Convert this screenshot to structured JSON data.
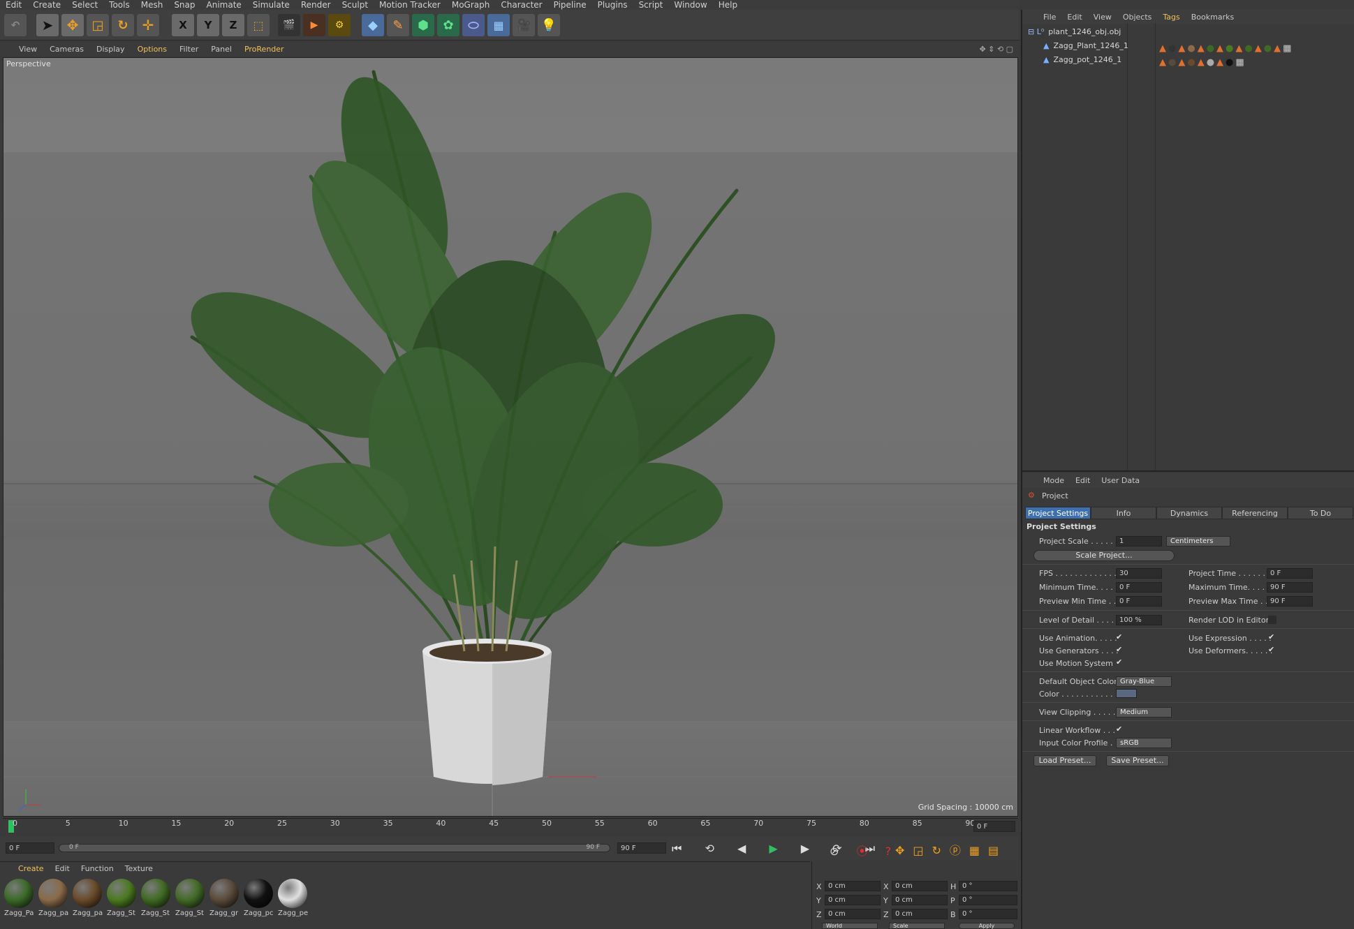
{
  "menu": [
    "Edit",
    "Create",
    "Select",
    "Tools",
    "Mesh",
    "Snap",
    "Animate",
    "Simulate",
    "Render",
    "Sculpt",
    "Motion Tracker",
    "MoGraph",
    "Character",
    "Pipeline",
    "Plugins",
    "Script",
    "Window",
    "Help"
  ],
  "toolbar": {
    "x": "X",
    "y": "Y",
    "z": "Z"
  },
  "viewport_menu": [
    "View",
    "Cameras",
    "Display",
    "Options",
    "Filter",
    "Panel",
    "ProRender"
  ],
  "viewport": {
    "label": "Perspective",
    "grid_spacing": "Grid Spacing : 10000 cm"
  },
  "timeline": {
    "ticks": [
      "0",
      "5",
      "10",
      "15",
      "20",
      "25",
      "30",
      "35",
      "40",
      "45",
      "50",
      "55",
      "60",
      "65",
      "70",
      "75",
      "80",
      "85",
      "90"
    ],
    "current": "0 F"
  },
  "transport": {
    "start": "0 F",
    "range_start": "0 F",
    "range_end": "90 F",
    "end": "90 F"
  },
  "material_menu": [
    "Create",
    "Edit",
    "Function",
    "Texture"
  ],
  "materials": [
    {
      "name": "Zagg_Pa",
      "color": "#3a6a28"
    },
    {
      "name": "Zagg_pa",
      "color": "#8a6a48"
    },
    {
      "name": "Zagg_pa",
      "color": "#6a4a2a"
    },
    {
      "name": "Zagg_St",
      "color": "#4a7a20"
    },
    {
      "name": "Zagg_St",
      "color": "#3f6a22"
    },
    {
      "name": "Zagg_St",
      "color": "#426a26"
    },
    {
      "name": "Zagg_gr",
      "color": "#5a4a3a"
    },
    {
      "name": "Zagg_pc",
      "color": "#111111"
    },
    {
      "name": "Zagg_pe",
      "color": "#e0e0e0"
    }
  ],
  "coords": {
    "x1": "0 cm",
    "x2": "0 cm",
    "h": "0 °",
    "y1": "0 cm",
    "y2": "0 cm",
    "p": "0 °",
    "z1": "0 cm",
    "z2": "0 cm",
    "b": "0 °",
    "world": "World",
    "scale": "Scale",
    "apply": "Apply",
    "labels": {
      "x": "X",
      "y": "Y",
      "z": "Z",
      "h": "H",
      "p": "P",
      "b": "B"
    }
  },
  "object_menu": [
    "File",
    "Edit",
    "View",
    "Objects",
    "Tags",
    "Bookmarks"
  ],
  "objects": [
    {
      "name": "plant_1246_obj.obj",
      "indent": 0
    },
    {
      "name": "Zagg_Plant_1246_1",
      "indent": 1
    },
    {
      "name": "Zagg_pot_1246_1",
      "indent": 1
    }
  ],
  "attr_menu": [
    "Mode",
    "Edit",
    "User Data"
  ],
  "attr": {
    "title": "Project",
    "tabs": [
      "Project Settings",
      "Info",
      "Dynamics",
      "Referencing",
      "To Do"
    ],
    "section": "Project Settings",
    "project_scale_label": "Project Scale . . . . . .",
    "project_scale": "1",
    "scale_unit": "Centimeters",
    "scale_project": "Scale Project...",
    "fps_label": "FPS . . . . . . . . . . . . . .",
    "fps": "30",
    "project_time_label": "Project Time . . . . . . . .",
    "project_time": "0 F",
    "min_time_label": "Minimum Time. . . . .",
    "min_time": "0 F",
    "max_time_label": "Maximum Time. . . . . .",
    "max_time": "90 F",
    "prev_min_label": "Preview Min Time . .",
    "prev_min": "0 F",
    "prev_max_label": "Preview Max Time . . .",
    "prev_max": "90 F",
    "lod_label": "Level of Detail . . . . .",
    "lod": "100 %",
    "render_lod_label": "Render LOD in Editor",
    "use_anim_label": "Use Animation. . . . .",
    "use_expr_label": "Use Expression . . . . .",
    "use_gen_label": "Use Generators . . . .",
    "use_def_label": "Use Deformers. . . . . .",
    "use_motion_label": "Use Motion System",
    "def_color_label": "Default Object Color",
    "def_color": "Gray-Blue",
    "color_label": "Color . . . . . . . . . . . .",
    "clipping_label": "View Clipping . . . . .",
    "clipping": "Medium",
    "linear_label": "Linear Workflow . . .",
    "input_profile_label": "Input Color Profile .",
    "input_profile": "sRGB",
    "load_preset": "Load Preset...",
    "save_preset": "Save Preset..."
  }
}
